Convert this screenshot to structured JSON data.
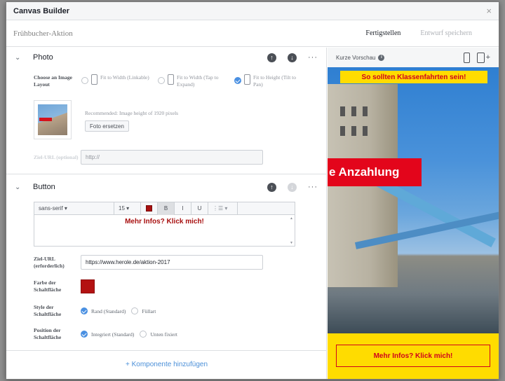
{
  "dialog": {
    "title": "Canvas Builder",
    "close": "×",
    "doc_name": "Frühbucher-Aktion",
    "finish_label": "Fertigstellen",
    "save_label": "Entwurf speichern"
  },
  "photo": {
    "title": "Photo",
    "layout_label": "Choose an Image Layout",
    "options": [
      {
        "label": "Fit to Width (Linkable)",
        "selected": false
      },
      {
        "label": "Fit to Width (Tap to Expand)",
        "selected": false
      },
      {
        "label": "Fit to Height (Tilt to Pan)",
        "selected": true
      }
    ],
    "recommend": "Recommended: Image height of 1920 pixels",
    "replace_btn": "Foto ersetzen",
    "url_label": "Ziel-URL (optional)",
    "url_placeholder": "http://"
  },
  "button_section": {
    "title": "Button",
    "font": "sans-serif ▾",
    "size": "15 ▾",
    "bold": "B",
    "italic": "I",
    "underline": "U",
    "align": "⋮☰ ▾",
    "text": "Mehr Infos? Klick mich!",
    "url_label": "Ziel-URL (erforderlich)",
    "url_value": "https://www.herole.de/aktion-2017",
    "color_label": "Farbe der Schaltfläche",
    "button_color": "#b31212",
    "style_label": "Style der Schaltfläche",
    "style_options": [
      {
        "label": "Rand (Standard)",
        "selected": true
      },
      {
        "label": "Füllart",
        "selected": false
      }
    ],
    "position_label": "Position der Schaltfläche",
    "position_options": [
      {
        "label": "Integriert (Standard)",
        "selected": true
      },
      {
        "label": "Unten fixiert",
        "selected": false
      }
    ]
  },
  "add_component": "+ Komponente hinzufügen",
  "preview": {
    "title": "Kurze Vorschau",
    "info": "i",
    "plus": "+",
    "banner": "So sollten Klassenfahrten sein!",
    "red_text": "e Anzahlung",
    "button": "Mehr Infos? Klick mich!"
  }
}
